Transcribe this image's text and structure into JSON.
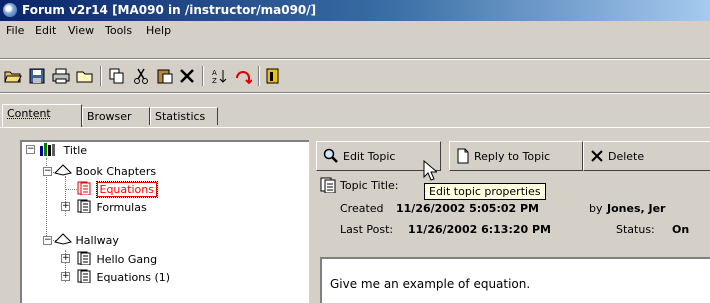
{
  "window": {
    "title": "Forum v2r14  [MA090 in /instructor/ma090/]"
  },
  "menu": {
    "items": [
      "File",
      "Edit",
      "View",
      "Tools",
      "Help"
    ]
  },
  "toolbar": {
    "buttons": [
      "open-folder",
      "save",
      "print",
      "new-folder",
      "copy",
      "cut",
      "paste",
      "delete",
      "sort",
      "refresh",
      "exit"
    ]
  },
  "tabs": [
    {
      "label": "Content",
      "active": true
    },
    {
      "label": "Browser",
      "active": false
    },
    {
      "label": "Statistics",
      "active": false
    }
  ],
  "tree": {
    "root": "Title",
    "nodes": [
      {
        "label": "Book Chapters",
        "level": 1,
        "expander": "−"
      },
      {
        "label": "Equations",
        "level": 2,
        "selected": true
      },
      {
        "label": "Formulas",
        "level": 2,
        "expander": "+"
      },
      {
        "label": "Hallway",
        "level": 1,
        "expander": "−"
      },
      {
        "label": "Hello Gang",
        "level": 2,
        "expander": "+"
      },
      {
        "label": "Equations (1)",
        "level": 2,
        "expander": "+"
      }
    ]
  },
  "topic_toolbar": {
    "edit_label": "Edit Topic",
    "reply_label": "Reply to Topic",
    "delete_label": "Delete"
  },
  "topic": {
    "title_label": "Topic Title:",
    "created_label": "Created",
    "created_value": "11/26/2002 5:05:02 PM",
    "by_label": "by",
    "by_value": "Jones, Jer",
    "last_post_label": "Last Post:",
    "last_post_value": "11/26/2002 6:13:20 PM",
    "status_label": "Status:",
    "status_value": "On",
    "body_text": "Give me an example of equation."
  },
  "tooltip": {
    "text": "Edit topic properties"
  },
  "colors": {
    "title_start": "#0a246a",
    "title_end": "#a6caf0",
    "selection_border": "#ff0000",
    "tooltip_bg": "#ffffe1"
  }
}
